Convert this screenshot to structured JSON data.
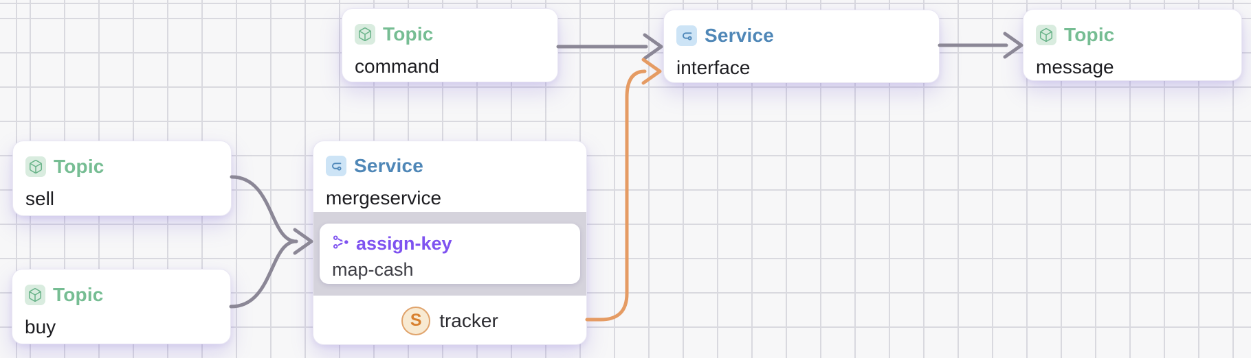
{
  "canvas": {
    "grid_size_px": 50,
    "background_color": "#f7f7f8",
    "grid_line_color": "#d9d9df"
  },
  "colors": {
    "topic_accent": "#76bd93",
    "topic_icon_bg": "#d9ecdf",
    "service_accent": "#4f87b7",
    "service_icon_bg": "#cde4f6",
    "function_accent": "#7e52f0",
    "edge_default": "#8b8796",
    "edge_highlight": "#e59b63",
    "consumer_badge_bg": "#f8ead2",
    "consumer_badge_border": "#e0a36b"
  },
  "nodes": {
    "command": {
      "type_label": "Topic",
      "name": "command"
    },
    "interface": {
      "type_label": "Service",
      "name": "interface"
    },
    "message": {
      "type_label": "Topic",
      "name": "message"
    },
    "sell": {
      "type_label": "Topic",
      "name": "sell"
    },
    "buy": {
      "type_label": "Topic",
      "name": "buy"
    },
    "mergeservice": {
      "type_label": "Service",
      "name": "mergeservice",
      "function": {
        "type_label": "assign-key",
        "name": "map-cash"
      },
      "consumer": {
        "initial": "S",
        "name": "tracker"
      }
    }
  },
  "edges": [
    {
      "from": "command",
      "to": "interface",
      "color": "#8b8796"
    },
    {
      "from": "interface",
      "to": "message",
      "color": "#8b8796"
    },
    {
      "from": "sell",
      "to": "mergeservice",
      "color": "#8b8796"
    },
    {
      "from": "buy",
      "to": "mergeservice",
      "color": "#8b8796"
    },
    {
      "from": "mergeservice.tracker",
      "to": "interface",
      "color": "#e59b63"
    }
  ]
}
